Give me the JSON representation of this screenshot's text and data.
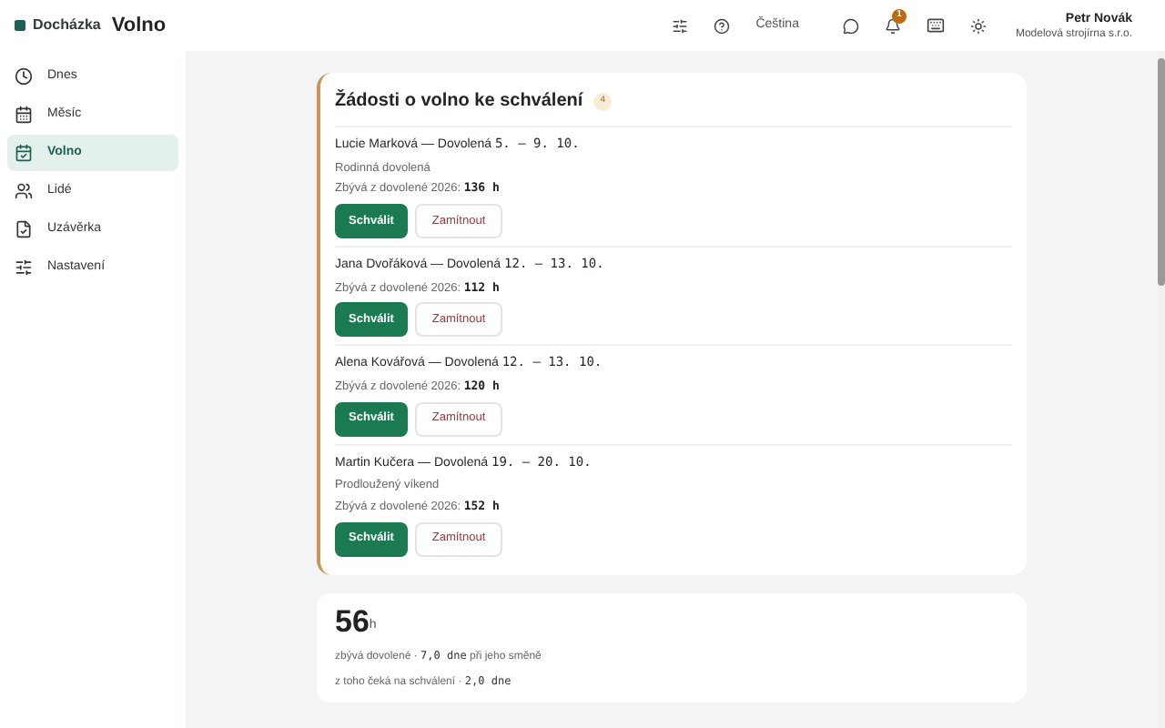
{
  "header": {
    "app_name": "Docházka",
    "page_title": "Volno",
    "language": "Čeština",
    "notification_count": "1",
    "user_name": "Petr Novák",
    "company": "Modelová strojírna s.r.o."
  },
  "sidebar": {
    "items": [
      {
        "label": "Dnes",
        "kind": "clock",
        "selected": false
      },
      {
        "label": "Měsíc",
        "kind": "calendar",
        "selected": false
      },
      {
        "label": "Volno",
        "kind": "calendar-check",
        "selected": true
      },
      {
        "label": "Lidé",
        "kind": "users",
        "selected": false
      },
      {
        "label": "Uzávěrka",
        "kind": "file-check",
        "selected": false
      },
      {
        "label": "Nastavení",
        "kind": "sliders",
        "selected": false
      }
    ]
  },
  "requests_card": {
    "title": "Žádosti o volno ke schválení",
    "count": "4",
    "requests": [
      {
        "heading": "Lucie Marková — Dovolená",
        "dates": "5. – 9. 10.",
        "note": "Rodinná dovolená",
        "remaining_label": "Zbývá z dovolené 2026:",
        "remaining_value": "136 h",
        "approve_label": "Schválit",
        "reject_label": "Zamítnout"
      },
      {
        "heading": "Jana Dvořáková — Dovolená",
        "dates": "12. – 13. 10.",
        "remaining_label": "Zbývá z dovolené 2026:",
        "remaining_value": "112 h",
        "approve_label": "Schválit",
        "reject_label": "Zamítnout"
      },
      {
        "heading": "Alena Kovářová — Dovolená",
        "dates": "12. – 13. 10.",
        "remaining_label": "Zbývá z dovolené 2026:",
        "remaining_value": "120 h",
        "approve_label": "Schválit",
        "reject_label": "Zamítnout"
      },
      {
        "heading": "Martin Kučera — Dovolená",
        "dates": "19. – 20. 10.",
        "note": "Prodloužený víkend",
        "remaining_label": "Zbývá z dovolené 2026:",
        "remaining_value": "152 h",
        "approve_label": "Schválit",
        "reject_label": "Zamítnout"
      }
    ]
  },
  "balance_card": {
    "value": "56",
    "unit": "h",
    "lines": [
      {
        "prefix": "zbývá dovolené ·",
        "value": "7,0 dne",
        "suffix": "při jeho směně"
      },
      {
        "prefix": "z toho čeká na schválení ·",
        "value": "2,0 dne"
      }
    ]
  }
}
